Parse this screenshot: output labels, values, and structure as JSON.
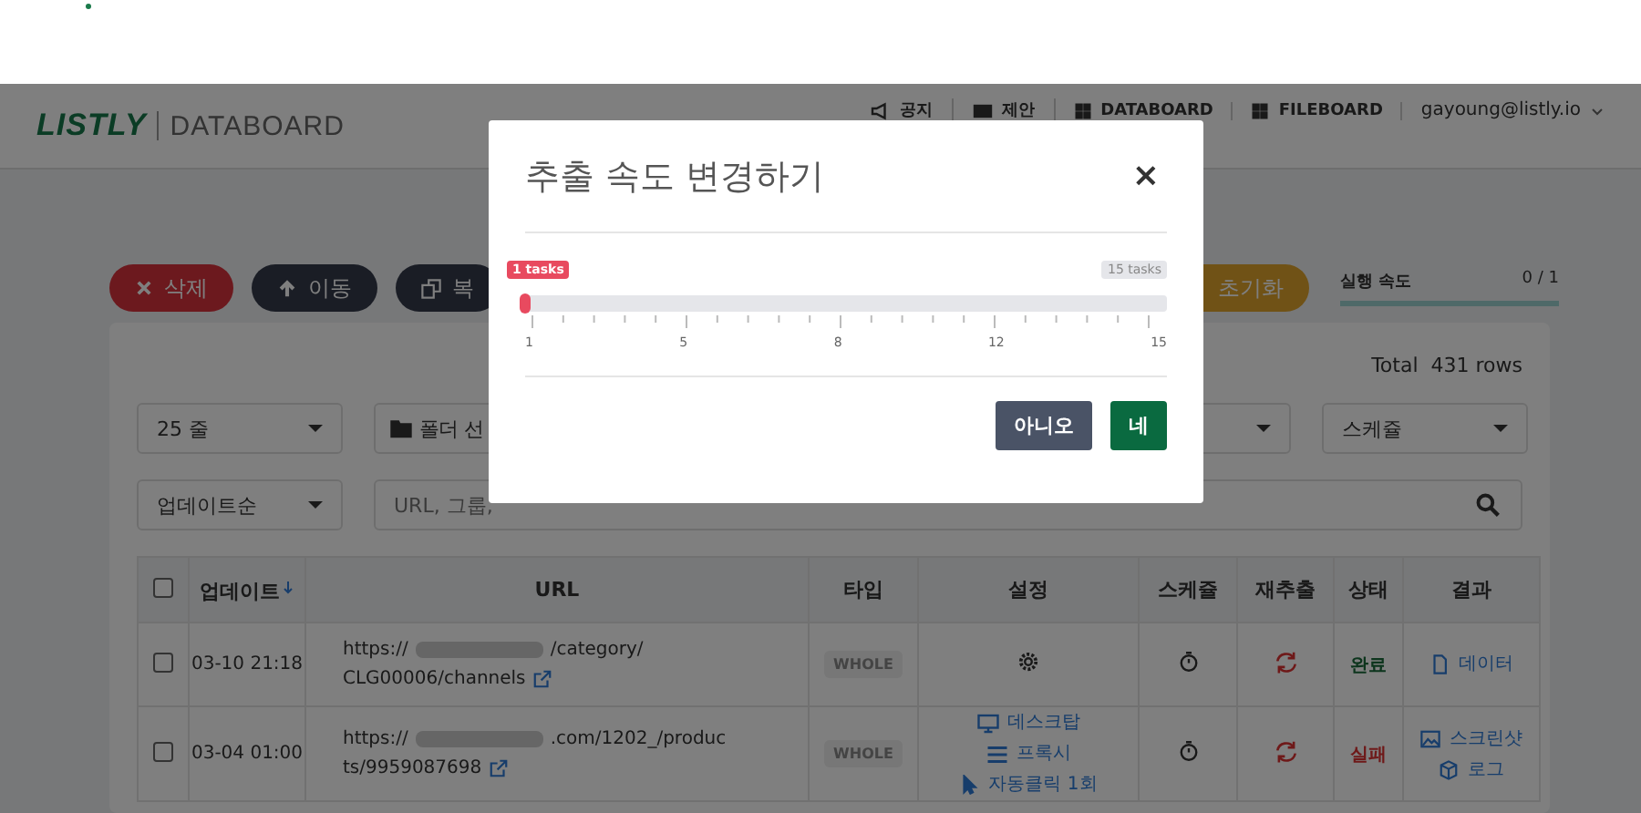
{
  "header": {
    "logo": "LISTLY",
    "product": "DATABOARD",
    "nav": [
      {
        "label": "공지"
      },
      {
        "label": "제안"
      },
      {
        "label": "DATABOARD"
      },
      {
        "label": "FILEBOARD"
      }
    ],
    "user": "gayoung@listly.io"
  },
  "toolbar": {
    "buttons": [
      {
        "label": "삭제",
        "kind": "danger"
      },
      {
        "label": "이동",
        "kind": "dark"
      },
      {
        "label": "복",
        "kind": "dark"
      },
      {
        "label": "초기화",
        "kind": "warning"
      }
    ],
    "speed": {
      "label": "실행 속도",
      "reading": "0 / 1"
    }
  },
  "panel": {
    "total": "Total  431 rows",
    "filters": [
      {
        "label": "25 줄",
        "kind": "select"
      },
      {
        "label": "폴더 선",
        "kind": "folder"
      },
      {
        "label": "스케쥴",
        "kind": "select"
      }
    ],
    "sort": "업데이트순",
    "search": {
      "placeholder": "URL, 그룹,"
    }
  },
  "table": {
    "header_checked": false,
    "columns": [
      "업데이트",
      "URL",
      "타입",
      "설정",
      "스케쥴",
      "재추출",
      "상태",
      "결과"
    ],
    "rows": [
      {
        "checked": false,
        "date": "03-10 21:18",
        "url": {
          "prefix": "https://",
          "suffix": "/category/",
          "line2": "CLG00006/channels"
        },
        "type": "WHOLE",
        "settings": [],
        "status": {
          "label": "완료",
          "kind": "done"
        },
        "results": [
          {
            "kind": "data",
            "label": "데이터"
          }
        ]
      },
      {
        "checked": false,
        "date": "03-04 01:00",
        "url": {
          "prefix": "https://",
          "suffix": ".com/1202_/produc",
          "line2": "ts/9959087698"
        },
        "type": "WHOLE",
        "settings": [
          {
            "kind": "device",
            "label": "데스크탑"
          },
          {
            "kind": "proxy",
            "label": "프록시"
          },
          {
            "kind": "click",
            "label": "자동클릭 1회"
          }
        ],
        "status": {
          "label": "실패",
          "kind": "failed"
        },
        "results": [
          {
            "kind": "screenshot",
            "label": "스크린샷"
          },
          {
            "kind": "log",
            "label": "로그"
          }
        ]
      }
    ]
  },
  "dialog": {
    "title": "추출 속도 변경하기",
    "close": "×",
    "slider": {
      "value_label": "1 tasks",
      "max_label": "15 tasks",
      "level": 0,
      "scale": [
        "1",
        "5",
        "8",
        "12",
        "15"
      ]
    },
    "buttons": [
      {
        "label": "아니오",
        "kind": "secondary"
      },
      {
        "label": "네",
        "kind": "primary"
      }
    ]
  }
}
